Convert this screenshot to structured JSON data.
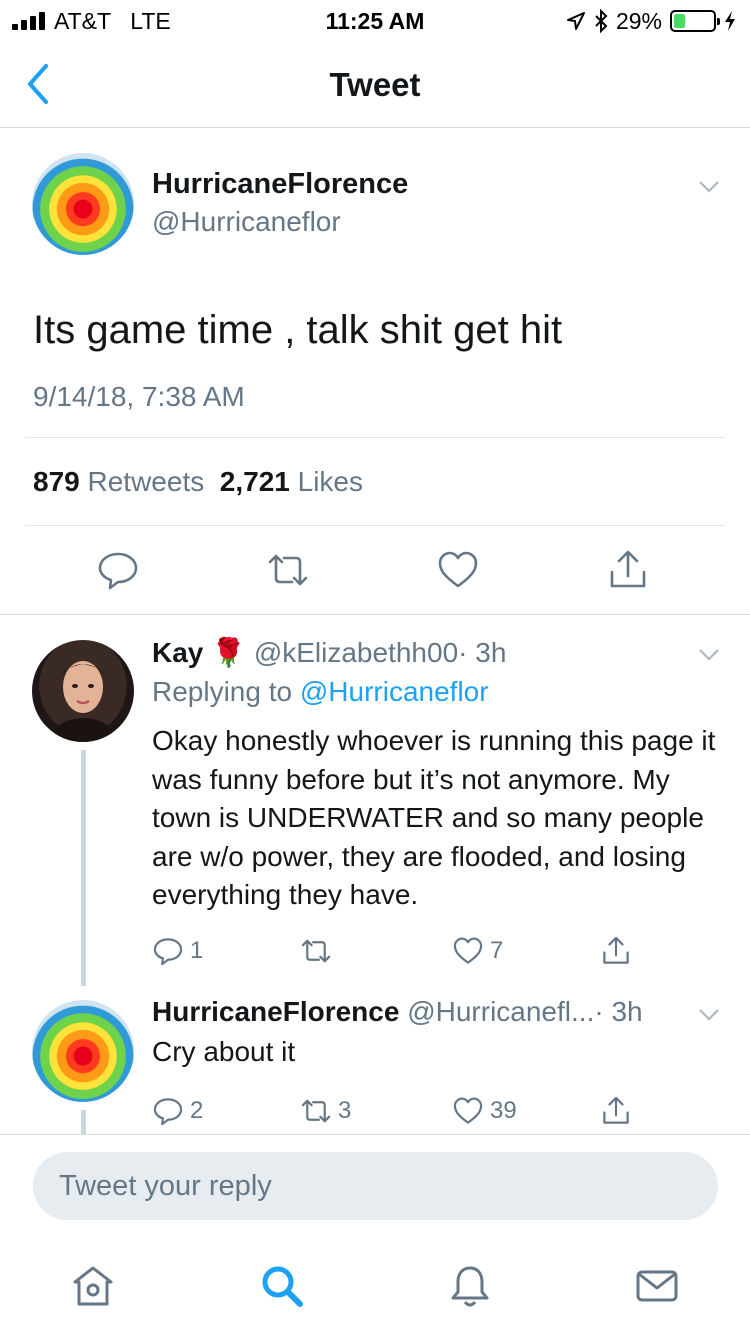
{
  "status_bar": {
    "carrier": "AT&T",
    "network": "LTE",
    "time": "11:25 AM",
    "battery_percent": "29%",
    "battery_level": 0.29,
    "icons": [
      "signal-icon",
      "location-icon",
      "bluetooth-icon",
      "battery-icon",
      "charging-icon"
    ]
  },
  "nav": {
    "title": "Tweet",
    "back_icon": "chevron-left-icon"
  },
  "main_tweet": {
    "author_name": "HurricaneFlorence",
    "author_handle": "@Hurricaneflor",
    "text": "Its game time , talk shit get hit",
    "timestamp": "9/14/18, 7:38 AM",
    "retweet_count": "879",
    "retweet_label": "Retweets",
    "like_count": "2,721",
    "like_label": "Likes"
  },
  "replies": [
    {
      "author_name": "Kay",
      "emoji": "🌹",
      "author_handle": "@kElizabethh00",
      "time": "· 3h",
      "replying_prefix": "Replying to",
      "replying_to": "@Hurricaneflor",
      "text": "Okay honestly whoever is running this page it was funny before but it’s not anymore. My town is UNDERWATER and so many people are w/o power, they are flooded, and losing everything they have.",
      "reply_count": "1",
      "retweet_count": "",
      "like_count": "7"
    },
    {
      "author_name": "HurricaneFlorence",
      "author_handle": "@Hurricanefl...",
      "time": "· 3h",
      "text": "Cry about it",
      "reply_count": "2",
      "retweet_count": "3",
      "like_count": "39"
    }
  ],
  "composer": {
    "placeholder": "Tweet your reply"
  },
  "tab_bar": {
    "tabs": [
      "home-icon",
      "search-icon",
      "notifications-icon",
      "messages-icon"
    ],
    "active_color": "#1da1f2"
  },
  "colors": {
    "accent": "#1da1f2",
    "secondary_text": "#657786",
    "divider": "#e1e8ed"
  }
}
